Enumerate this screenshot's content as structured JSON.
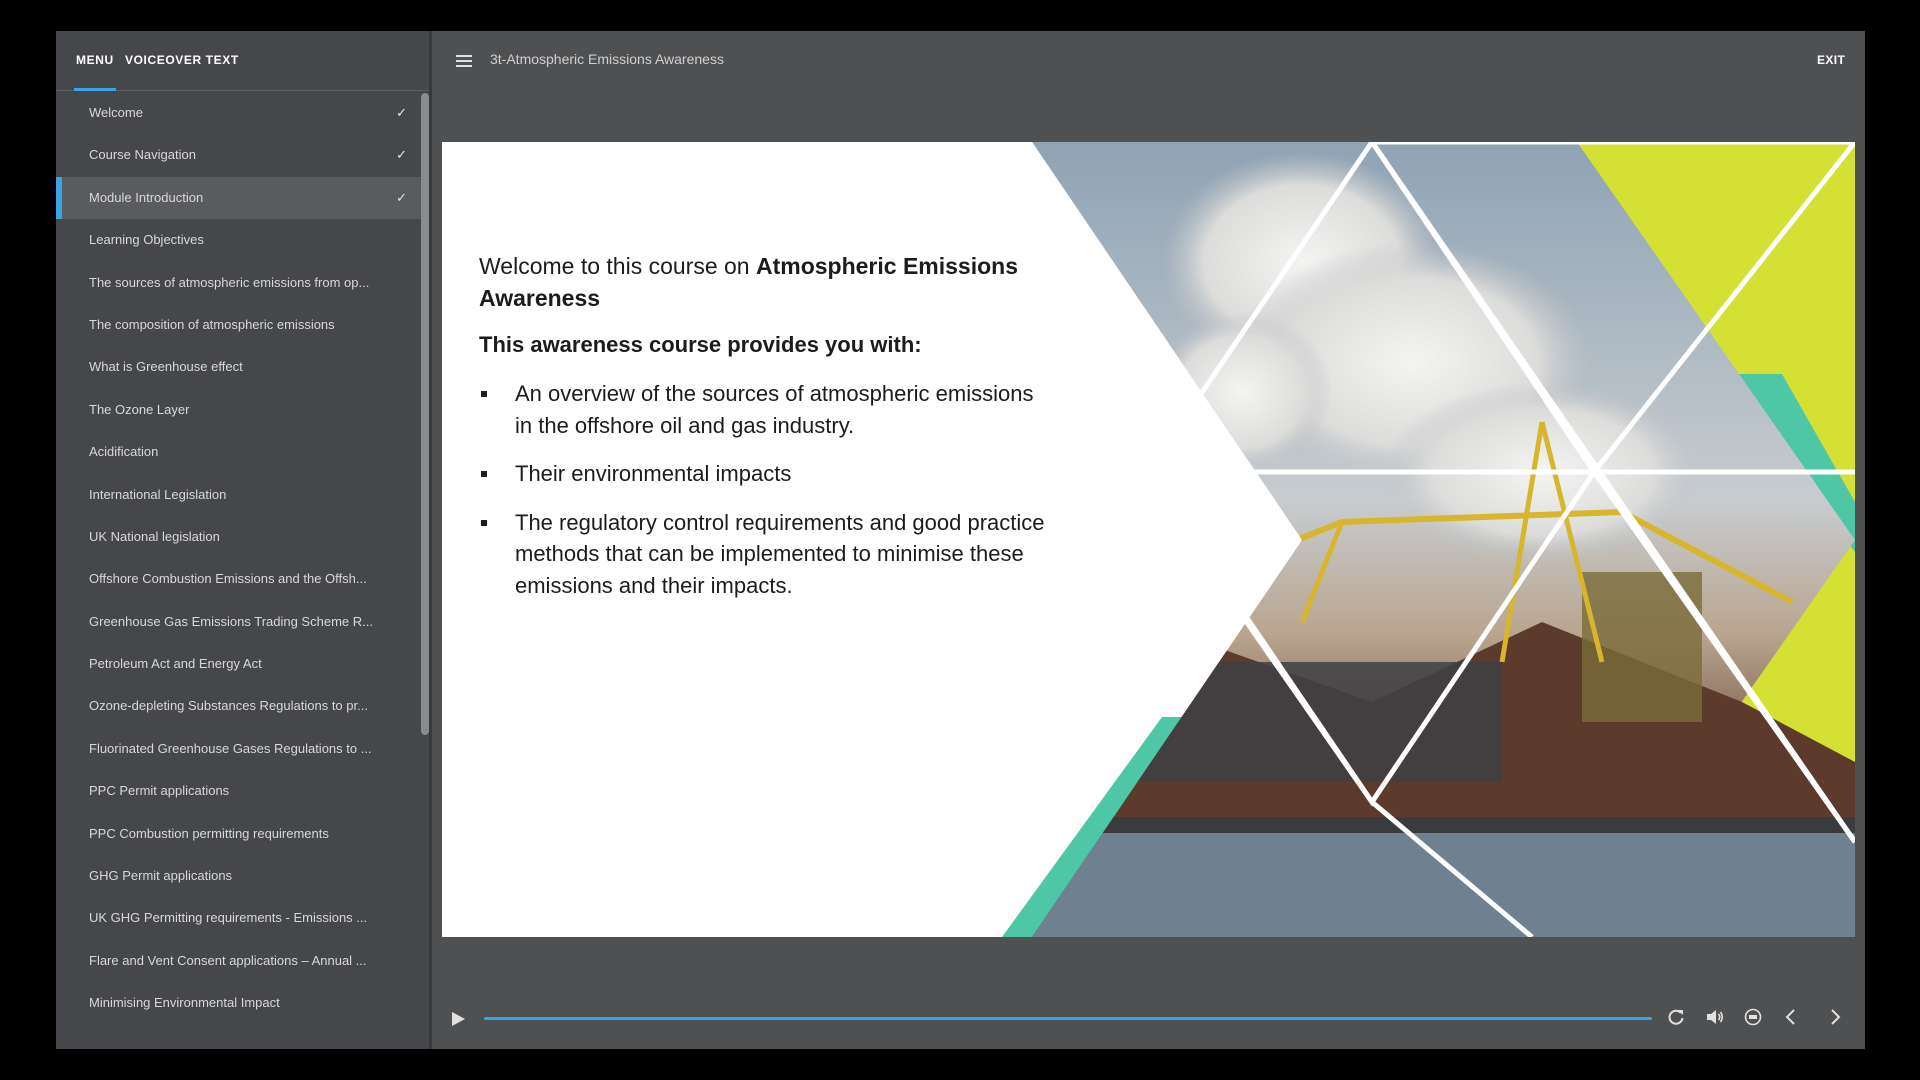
{
  "sidebar": {
    "tabs": {
      "menu": "MENU",
      "voiceover": "VOICEOVER TEXT"
    },
    "items": [
      {
        "label": "Welcome",
        "completed": true,
        "active": false
      },
      {
        "label": "Course Navigation",
        "completed": true,
        "active": false
      },
      {
        "label": "Module Introduction",
        "completed": true,
        "active": true
      },
      {
        "label": "Learning Objectives",
        "completed": false,
        "active": false
      },
      {
        "label": "The sources of atmospheric emissions from op...",
        "completed": false,
        "active": false
      },
      {
        "label": "The composition of atmospheric emissions",
        "completed": false,
        "active": false
      },
      {
        "label": "What is Greenhouse effect",
        "completed": false,
        "active": false
      },
      {
        "label": "The Ozone Layer",
        "completed": false,
        "active": false
      },
      {
        "label": "Acidification",
        "completed": false,
        "active": false
      },
      {
        "label": "International Legislation",
        "completed": false,
        "active": false
      },
      {
        "label": "UK National legislation",
        "completed": false,
        "active": false
      },
      {
        "label": "Offshore Combustion Emissions and the Offsh...",
        "completed": false,
        "active": false
      },
      {
        "label": "Greenhouse Gas Emissions Trading Scheme R...",
        "completed": false,
        "active": false
      },
      {
        "label": "Petroleum Act and Energy Act",
        "completed": false,
        "active": false
      },
      {
        "label": "Ozone-depleting Substances Regulations to pr...",
        "completed": false,
        "active": false
      },
      {
        "label": "Fluorinated Greenhouse Gases Regulations to ...",
        "completed": false,
        "active": false
      },
      {
        "label": "PPC Permit applications",
        "completed": false,
        "active": false
      },
      {
        "label": "PPC Combustion permitting requirements",
        "completed": false,
        "active": false
      },
      {
        "label": "GHG Permit applications",
        "completed": false,
        "active": false
      },
      {
        "label": "UK GHG Permitting requirements - Emissions ...",
        "completed": false,
        "active": false
      },
      {
        "label": "Flare and Vent Consent applications – Annual ...",
        "completed": false,
        "active": false
      },
      {
        "label": "Minimising Environmental Impact",
        "completed": false,
        "active": false
      }
    ],
    "check_glyph": "✓"
  },
  "header": {
    "course_title": "3t-Atmospheric Emissions Awareness",
    "exit_label": "EXIT",
    "menu_icon": "hamburger-icon"
  },
  "slide": {
    "heading_prefix": "Welcome to this course on ",
    "heading_bold": "Atmospheric Emissions Awareness",
    "subheading": "This awareness course provides you with:",
    "bullets": [
      "An overview of the sources of atmospheric emissions in the offshore oil and gas industry.",
      "Their environmental impacts",
      "The regulatory control requirements and good practice methods that can be implemented to minimise these emissions and their impacts."
    ]
  },
  "player": {
    "progress": 1.0,
    "icons": [
      "play-icon",
      "replay-icon",
      "volume-icon",
      "captions-icon",
      "chevron-left-icon",
      "chevron-right-icon"
    ]
  },
  "colors": {
    "accent": "#3ba4e4",
    "sidebar_bg": "#46474a",
    "app_bg": "#4f5052",
    "lime": "#d4e034",
    "teal": "#4fc7a6"
  }
}
